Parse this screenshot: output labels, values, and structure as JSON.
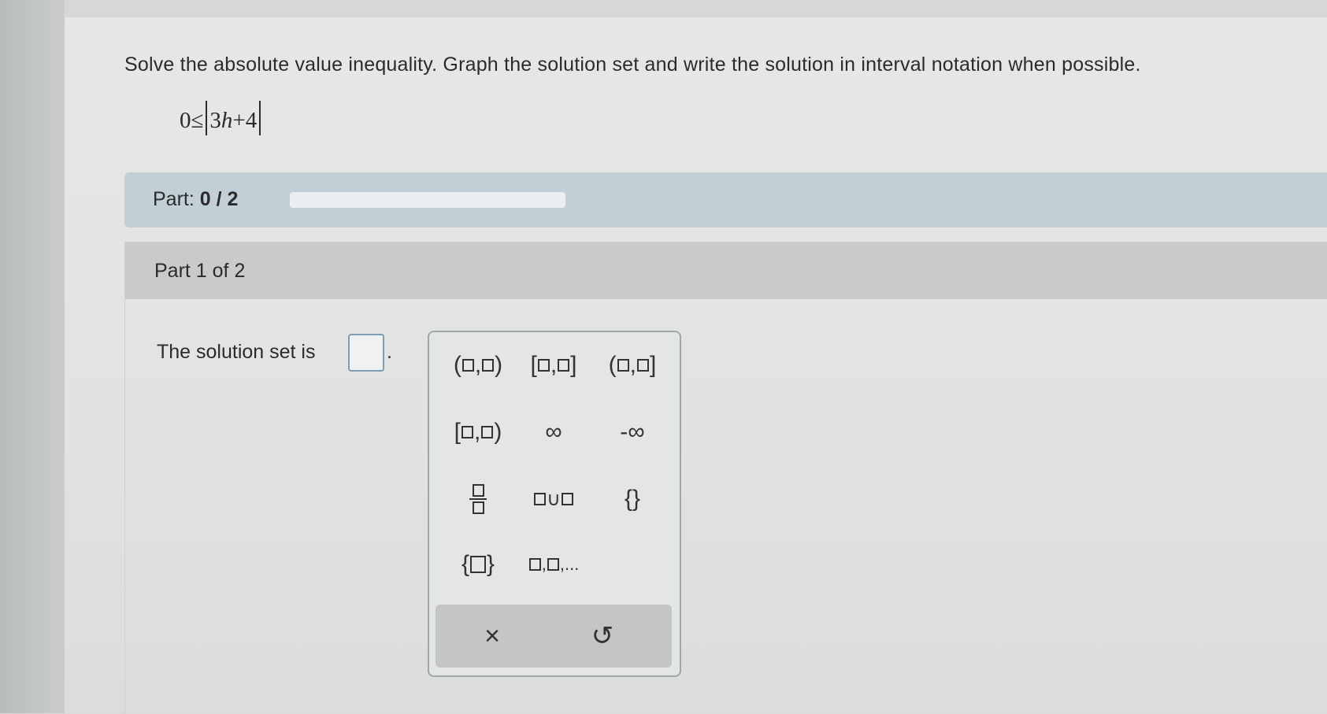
{
  "question": {
    "instruction": "Solve the absolute value inequality. Graph the solution set and write the solution in interval notation when possible.",
    "inequality_lhs": "0≤",
    "inequality_coef": "3",
    "inequality_var": "h",
    "inequality_rest": "+4"
  },
  "part_bar": {
    "label": "Part:",
    "progress_text": "0 / 2",
    "progress_fraction": 0
  },
  "part_section": {
    "header": "Part 1 of 2",
    "solution_prefix": "The solution set is",
    "period": "."
  },
  "palette": {
    "open_open": "(",
    "closed_closed": "[",
    "open_closed": "(",
    "closed_open": "[",
    "comma": ",",
    "infinity": "∞",
    "neg_infinity": "-∞",
    "union": "∪",
    "empty_set": "{}",
    "set_open": "{",
    "set_close": "}",
    "ellipsis": "...",
    "clear": "×",
    "undo": "↺"
  },
  "colors": {
    "part_bar": "#c3cfd6",
    "answer_border": "#7c9fb6",
    "palette_border": "#9ea7ad"
  }
}
